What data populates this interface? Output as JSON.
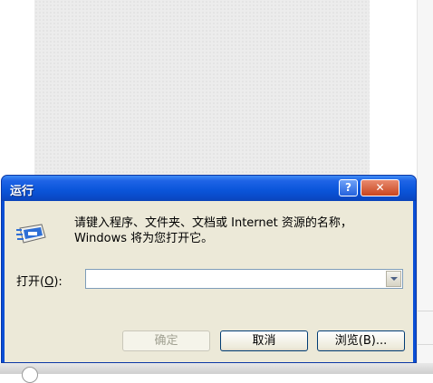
{
  "dialog": {
    "title": "运行",
    "prompt": "请键入程序、文件夹、文档或 Internet 资源的名称，Windows 将为您打开它。",
    "open_label_prefix": "打开(",
    "open_label_key": "O",
    "open_label_suffix": "):",
    "open_value": "",
    "buttons": {
      "ok": "确定",
      "cancel": "取消",
      "browse": "浏览(B)..."
    },
    "title_buttons": {
      "help": "?",
      "close": "✕"
    }
  },
  "icons": [
    "run-icon",
    "help-icon",
    "close-icon",
    "chevron-down-icon"
  ],
  "colors": {
    "titlebar": "#0a56db",
    "dialog_body": "#ece9d8",
    "close_button": "#c8451f"
  }
}
